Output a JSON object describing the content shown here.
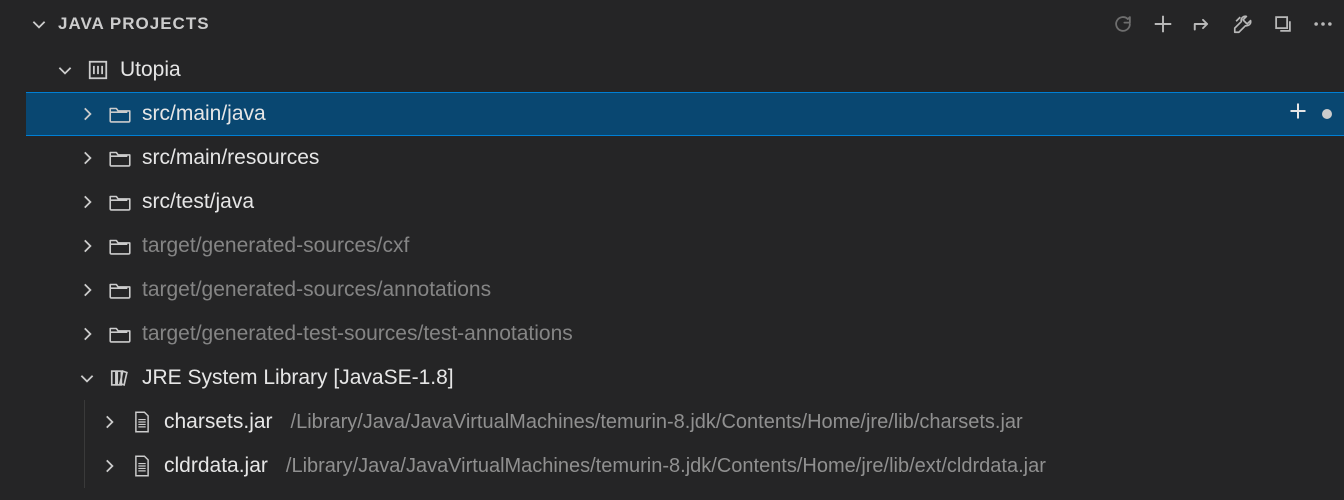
{
  "header": {
    "title": "JAVA PROJECTS"
  },
  "project": {
    "name": "Utopia"
  },
  "nodes": [
    {
      "label": "src/main/java",
      "dim": false,
      "selected": true,
      "icon": "folder",
      "showAdd": true
    },
    {
      "label": "src/main/resources",
      "dim": false,
      "selected": false,
      "icon": "folder"
    },
    {
      "label": "src/test/java",
      "dim": false,
      "selected": false,
      "icon": "folder"
    },
    {
      "label": "target/generated-sources/cxf",
      "dim": true,
      "selected": false,
      "icon": "folder"
    },
    {
      "label": "target/generated-sources/annotations",
      "dim": true,
      "selected": false,
      "icon": "folder"
    },
    {
      "label": "target/generated-test-sources/test-annotations",
      "dim": true,
      "selected": false,
      "icon": "folder"
    }
  ],
  "library": {
    "label": "JRE System Library [JavaSE-1.8]",
    "jars": [
      {
        "name": "charsets.jar",
        "path": "/Library/Java/JavaVirtualMachines/temurin-8.jdk/Contents/Home/jre/lib/charsets.jar"
      },
      {
        "name": "cldrdata.jar",
        "path": "/Library/Java/JavaVirtualMachines/temurin-8.jdk/Contents/Home/jre/lib/ext/cldrdata.jar"
      }
    ]
  }
}
